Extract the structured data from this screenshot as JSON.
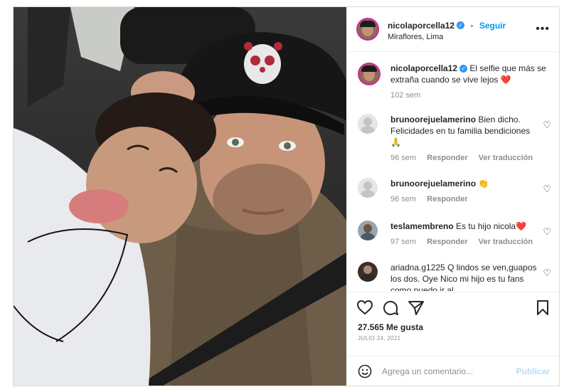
{
  "header": {
    "username": "nicolaporcella12",
    "follow_label": "Seguir",
    "separator": "•",
    "location": "Miraflores, Lima",
    "more_icon": "more-icon"
  },
  "caption": {
    "username": "nicolaporcella12",
    "text": "El selfie que más se extraña cuando se vive lejos",
    "emoji": "❤️",
    "age": "102 sem"
  },
  "comments": [
    {
      "username": "brunoorejuelamerino",
      "text": "Bien dicho. Felicidades en tu familia bendiciones",
      "emoji": "🙏",
      "age": "96 sem",
      "reply": "Responder",
      "translate": "Ver traducción"
    },
    {
      "username": "brunoorejuelamerino",
      "text": "",
      "emoji": "👏",
      "age": "96 sem",
      "reply": "Responder",
      "translate": ""
    },
    {
      "username": "teslamembreno",
      "text": "Es tu hijo nicola",
      "emoji": "❤️",
      "age": "97 sem",
      "reply": "Responder",
      "translate": "Ver traducción"
    },
    {
      "username": "ariadna.g1225",
      "text": "Q lindos se ven,guapos los dos. Oye Nico mi hijo es tu fans como puedo ir al",
      "emoji": "",
      "age": "",
      "reply": "",
      "translate": ""
    }
  ],
  "actions": {
    "likes": "27.565 Me gusta",
    "date": "JULIO 24, 2021"
  },
  "add_comment": {
    "placeholder": "Agrega un comentario...",
    "post_label": "Publicar"
  },
  "colors": {
    "accent": "#0095f6",
    "verified": "#3897f0",
    "muted": "#8e8e8e"
  }
}
